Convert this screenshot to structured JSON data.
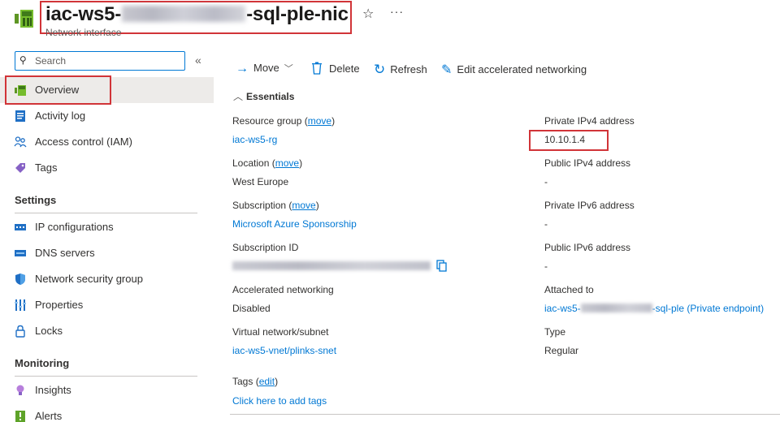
{
  "header": {
    "title_prefix": "iac-ws5-",
    "title_suffix": "-sql-ple-nic",
    "subtitle": "Network interface",
    "star_icon": "☆",
    "more_icon": "···"
  },
  "sidebar": {
    "search_placeholder": "Search",
    "collapse_icon": "«",
    "items": [
      {
        "label": "Overview"
      },
      {
        "label": "Activity log"
      },
      {
        "label": "Access control (IAM)"
      },
      {
        "label": "Tags"
      }
    ],
    "settings_title": "Settings",
    "settings_items": [
      {
        "label": "IP configurations"
      },
      {
        "label": "DNS servers"
      },
      {
        "label": "Network security group"
      },
      {
        "label": "Properties"
      },
      {
        "label": "Locks"
      }
    ],
    "monitoring_title": "Monitoring",
    "monitoring_items": [
      {
        "label": "Insights"
      },
      {
        "label": "Alerts"
      }
    ]
  },
  "toolbar": {
    "move_label": "Move",
    "delete_label": "Delete",
    "refresh_label": "Refresh",
    "edit_accel_label": "Edit accelerated networking"
  },
  "essentials": {
    "title": "Essentials",
    "left": {
      "resource_group_label": "Resource group",
      "move_link": "move",
      "resource_group_value": "iac-ws5-rg",
      "location_label": "Location",
      "location_value": "West Europe",
      "subscription_label": "Subscription",
      "subscription_value": "Microsoft Azure Sponsorship",
      "subscription_id_label": "Subscription ID",
      "accel_net_label": "Accelerated networking",
      "accel_net_value": "Disabled",
      "vnet_label": "Virtual network/subnet",
      "vnet_value": "iac-ws5-vnet/plinks-snet",
      "tags_label": "Tags",
      "tags_edit": "edit",
      "tags_add": "Click here to add tags"
    },
    "right": {
      "private_ipv4_label": "Private IPv4 address",
      "private_ipv4_value": "10.10.1.4",
      "public_ipv4_label": "Public IPv4 address",
      "public_ipv4_value": "-",
      "private_ipv6_label": "Private IPv6 address",
      "private_ipv6_value": "-",
      "public_ipv6_label": "Public IPv6 address",
      "public_ipv6_value": "-",
      "attached_label": "Attached to",
      "attached_prefix": "iac-ws5-",
      "attached_suffix": "-sql-ple (Private endpoint)",
      "type_label": "Type",
      "type_value": "Regular"
    }
  },
  "colors": {
    "accent": "#0078d4",
    "highlight_border": "#d13438",
    "selected_bg": "#edebe9"
  }
}
